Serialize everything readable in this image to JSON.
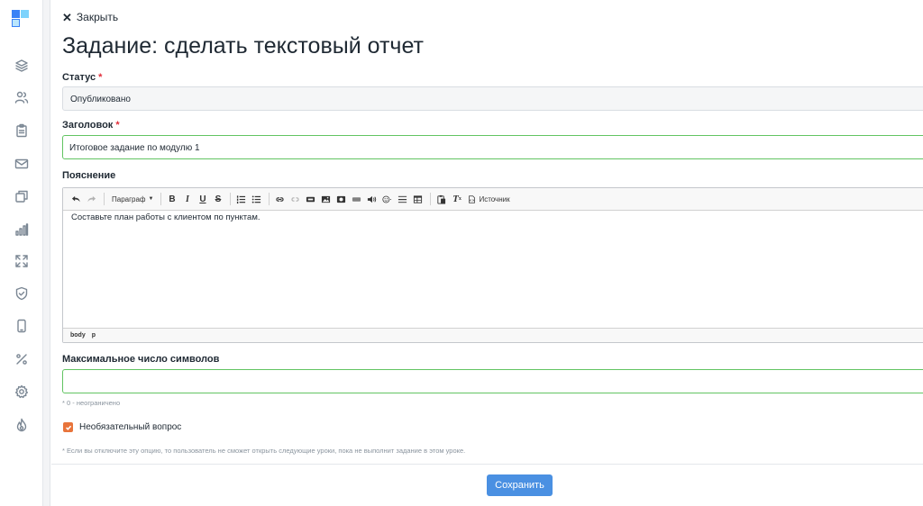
{
  "sidebar": {
    "logo": "app-logo",
    "items": [
      {
        "icon": "layers-icon"
      },
      {
        "icon": "users-icon"
      },
      {
        "icon": "clipboard-icon"
      },
      {
        "icon": "mail-icon"
      },
      {
        "icon": "copy-icon"
      },
      {
        "icon": "bar-chart-icon"
      },
      {
        "icon": "expand-icon"
      },
      {
        "icon": "shield-check-icon"
      },
      {
        "icon": "phone-icon"
      },
      {
        "icon": "percent-icon"
      },
      {
        "icon": "gear-icon"
      },
      {
        "icon": "flame-icon"
      }
    ]
  },
  "header": {
    "close_label": "Закрыть",
    "title": "Задание: сделать текстовый отчет"
  },
  "form": {
    "status": {
      "label": "Статус",
      "required_mark": "*",
      "value": "Опубликовано"
    },
    "heading": {
      "label": "Заголовок",
      "required_mark": "*",
      "value": "Итоговое задание по модулю 1"
    },
    "explanation": {
      "label": "Пояснение",
      "toolbar": {
        "format_label": "Параграф",
        "bold": "B",
        "italic": "I",
        "underline": "U",
        "strike": "S",
        "source_label": "Источник"
      },
      "content": "Составьте план работы с клиентом по пунктам.",
      "path": [
        "body",
        "p"
      ]
    },
    "max_chars": {
      "label": "Максимальное число символов",
      "value": "",
      "hint": "* 0 - неограничено"
    },
    "optional": {
      "label": "Необязательный вопрос",
      "checked": true,
      "hint": "* Если вы отключите эту опцию, то пользователь не сможет открыть следующие уроки, пока не выполнит задание в этом уроке."
    },
    "save_label": "Сохранить"
  },
  "colors": {
    "accent": "#4a90e2",
    "checkbox": "#e8743b",
    "valid_border": "#62c462",
    "required": "#e12d39"
  }
}
